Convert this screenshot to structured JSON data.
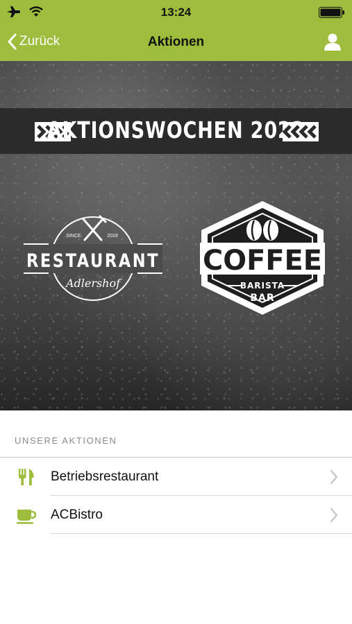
{
  "status_bar": {
    "time": "13:24",
    "icons": [
      "airplane-icon",
      "wifi-icon",
      "battery-icon"
    ]
  },
  "nav": {
    "back_label": "Zurück",
    "title": "Aktionen",
    "right_icon": "profile-icon"
  },
  "banner": {
    "headline": "AKTIONSWOCHEN 2022",
    "restaurant_logo": {
      "since": "SINCE",
      "year": "2019",
      "name": "RESTAURANT",
      "script": "Adlershof"
    },
    "coffee_logo": {
      "name": "COFFEE",
      "line1": "BARISTA",
      "line2": "BAR"
    }
  },
  "section": {
    "header": "UNSERE AKTIONEN"
  },
  "list": {
    "items": [
      {
        "label": "Betriebsrestaurant",
        "icon": "cutlery-icon"
      },
      {
        "label": "ACBistro",
        "icon": "coffee-cup-icon"
      }
    ]
  },
  "colors": {
    "accent": "#9ebd3c",
    "separator": "#c8c7cc"
  }
}
